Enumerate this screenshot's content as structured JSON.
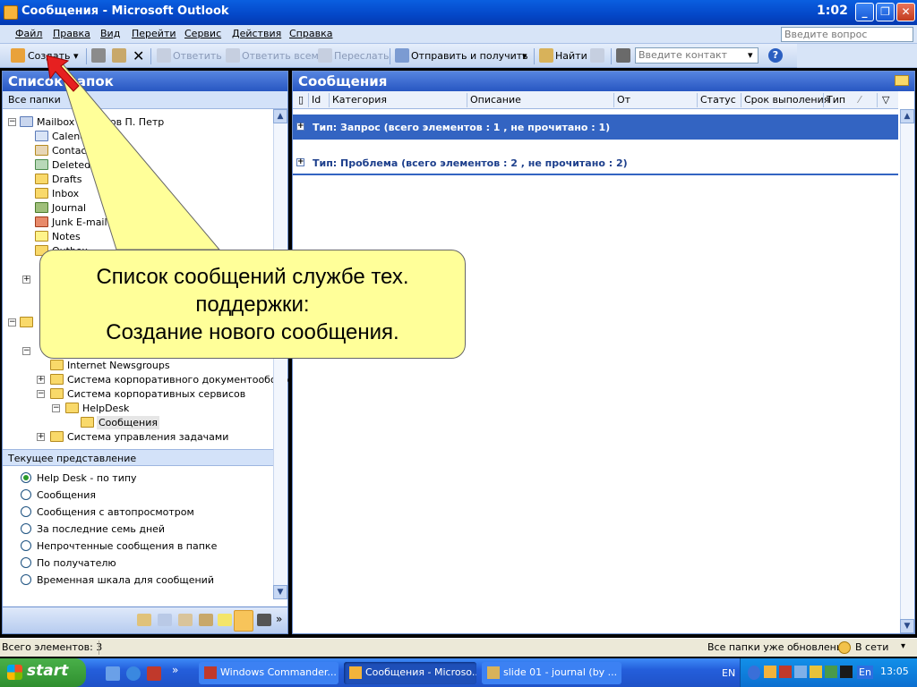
{
  "window": {
    "title": "Сообщения - Microsoft Outlook",
    "clock": "1:02",
    "minimize": "_",
    "maximize": "❐",
    "close": "✕"
  },
  "menu": {
    "items": [
      "Файл",
      "Правка",
      "Вид",
      "Перейти",
      "Сервис",
      "Действия",
      "Справка"
    ],
    "ask_placeholder": "Введите вопрос"
  },
  "toolbar": {
    "create": "Создать",
    "reply": "Ответить",
    "reply_all": "Ответить всем",
    "forward": "Переслать",
    "send_receive": "Отправить и получить",
    "find": "Найти",
    "contact_placeholder": "Введите контакт"
  },
  "left": {
    "header": "Список папок",
    "all_folders": "Все папки",
    "mailbox": "Mailbox - Иванов П. Петр",
    "folders": [
      "Calendar",
      "Contacts",
      "Deleted Items",
      "Drafts",
      "Inbox",
      "Journal",
      "Junk E-mail",
      "Notes",
      "Outbox"
    ],
    "public_folders": [
      "Internet Newsgroups",
      "Система корпоративного документооборота",
      "Система корпоративных сервисов",
      "HelpDesk",
      "Сообщения",
      "Система управления задачами"
    ],
    "current_view": "Текущее представление",
    "views": [
      "Help Desk - по типу",
      "Сообщения",
      "Сообщения с автопросмотром",
      "За последние семь дней",
      "Непрочтенные сообщения в папке",
      "По получателю",
      "Временная шкала для сообщений"
    ]
  },
  "right": {
    "header": "Сообщения",
    "columns": [
      "Id",
      "Категория",
      "Описание",
      "От",
      "Статус",
      "Срок выполения",
      "Тип"
    ],
    "groups": [
      "Тип: Запрос  (всего элементов : 1 , не прочитано : 1)",
      "Тип: Проблема  (всего элементов : 2 , не прочитано : 2)"
    ]
  },
  "status": {
    "left": "Всего элементов: 3",
    "right": "Все папки уже обновлены.",
    "online": "В сети"
  },
  "taskbar": {
    "start": "start",
    "tasks": [
      "Windows Commander...",
      "Сообщения - Microso...",
      "slide 01 - journal (by ..."
    ],
    "lang": "EN",
    "lang2": "En",
    "time": "13:05"
  },
  "callout": {
    "line1": "Список сообщений службе тех.",
    "line2": "поддержки:",
    "line3": "Создание нового сообщения."
  }
}
